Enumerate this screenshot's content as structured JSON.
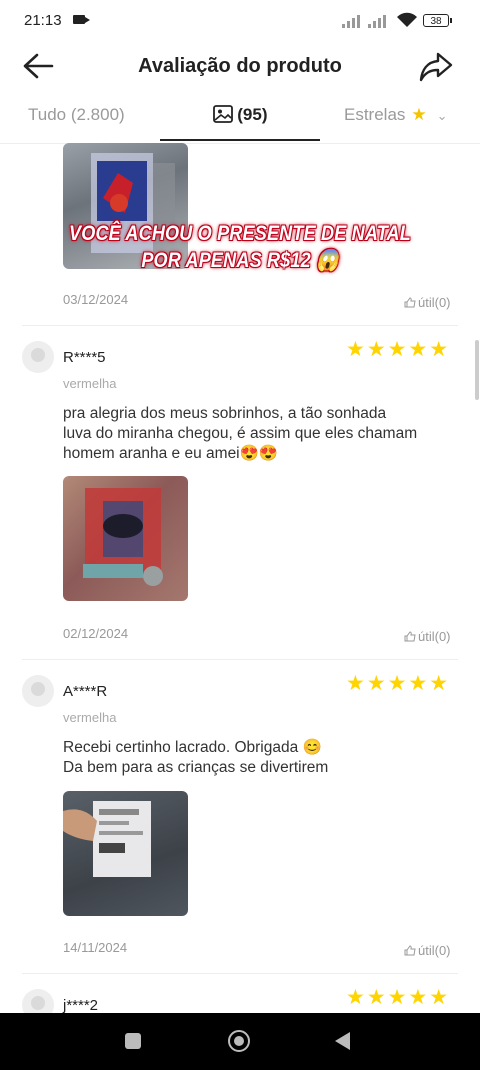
{
  "status_bar": {
    "time": "21:13",
    "battery": "38"
  },
  "header": {
    "title": "Avaliação do produto",
    "back_icon": "arrow-left-icon",
    "share_icon": "share-icon"
  },
  "tabs": {
    "all": "Tudo (2.800)",
    "photos": "(95)",
    "stars": "Estrelas"
  },
  "overlay": {
    "line1": "VOCÊ ACHOU O PRESENTE DE NATAL",
    "line2": "POR APENAS R$12 😱"
  },
  "reviews": [
    {
      "date": "03/12/2024",
      "useful": "útil(0)"
    },
    {
      "user": "R****5",
      "variant": "vermelha",
      "stars": "★★★★★",
      "text_line1": "pra alegria dos meus sobrinhos, a tão sonhada",
      "text_line2": "luva do miranha chegou, é assim que eles chamam",
      "text_line3": "homem aranha e eu amei😍😍",
      "date": "02/12/2024",
      "useful": "útil(0)"
    },
    {
      "user": "A****R",
      "variant": "vermelha",
      "stars": "★★★★★",
      "text_line1": "Recebi certinho lacrado. Obrigada 😊",
      "text_line2": "Da bem para as crianças se divertirem",
      "date": "14/11/2024",
      "useful": "útil(0)"
    },
    {
      "user": "j****2",
      "stars": "★★★★★"
    }
  ],
  "colors": {
    "star": "#ffd400",
    "accent_text": "#222222",
    "muted": "#999999"
  }
}
